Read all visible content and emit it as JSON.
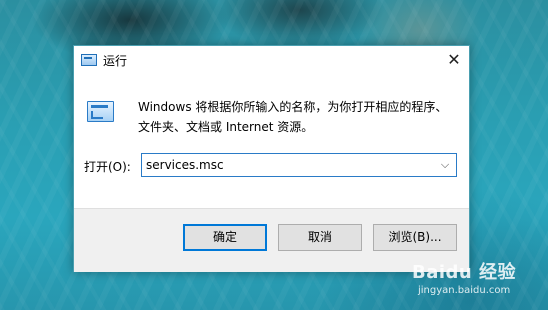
{
  "dialog": {
    "title": "运行",
    "close_glyph": "✕",
    "description": "Windows 将根据你所输入的名称，为你打开相应的程序、文件夹、文档或 Internet 资源。",
    "open_label": "打开(O):",
    "open_value": "services.msc",
    "dropdown_glyph": "⌵",
    "buttons": {
      "ok": "确定",
      "cancel": "取消",
      "browse": "浏览(B)..."
    }
  },
  "watermark": {
    "logo": "Baidu 经验",
    "url": "jingyan.baidu.com"
  },
  "colors": {
    "accent": "#0078d7",
    "focus_border": "#2a7bc7",
    "footer_bg": "#f0f0f0"
  },
  "icons": {
    "title": "run-app-icon",
    "body": "run-app-icon",
    "close": "close-icon",
    "dropdown": "chevron-down-icon"
  }
}
